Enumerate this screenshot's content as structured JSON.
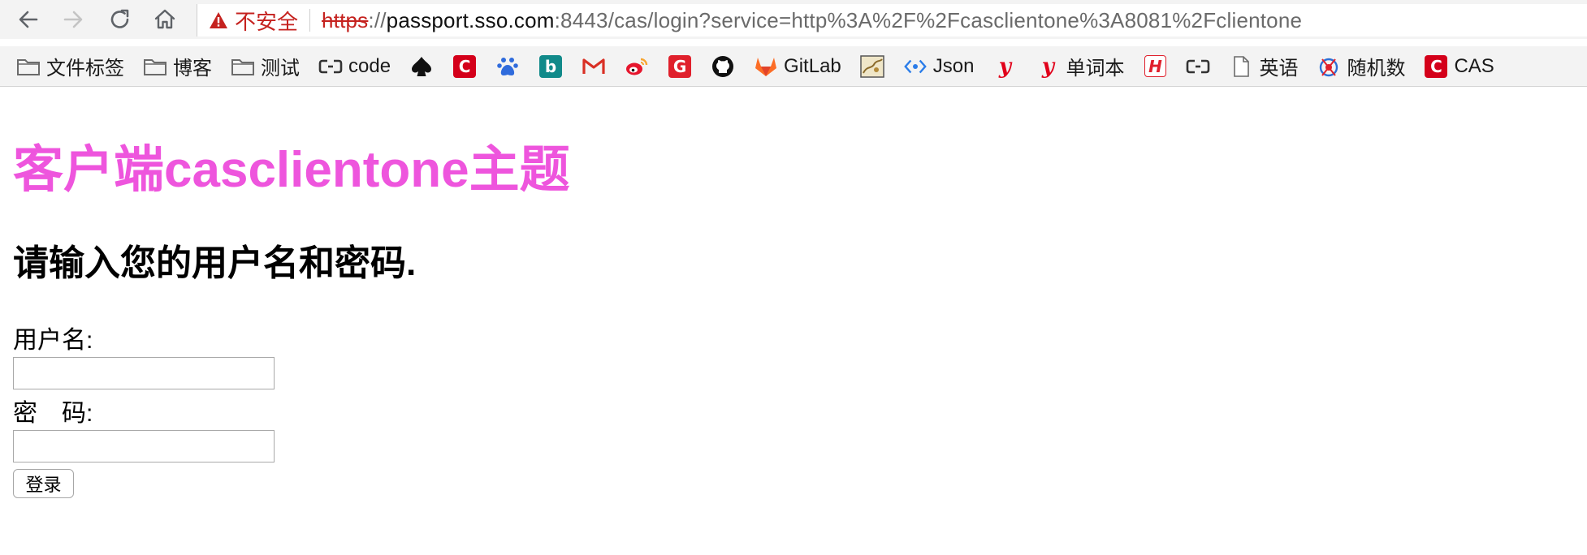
{
  "browser": {
    "security_label": "不安全",
    "url": {
      "scheme": "https",
      "separator": "://",
      "host": "passport.sso.com",
      "rest": ":8443/cas/login?service=http%3A%2F%2Fcasclientone%3A8081%2Fclientone"
    },
    "icons": {
      "back": "arrow-left-icon",
      "forward": "arrow-right-icon",
      "reload": "reload-icon",
      "home": "home-icon",
      "security": "warning-triangle-icon"
    },
    "colors": {
      "insecure": "#c5221f",
      "toolbar_bg": "#f3f3f3"
    }
  },
  "bookmarks": [
    {
      "icon": "folder-icon",
      "label": "文件标签"
    },
    {
      "icon": "folder-icon",
      "label": "博客"
    },
    {
      "icon": "folder-icon",
      "label": "测试"
    },
    {
      "icon": "link-icon",
      "label": "code"
    },
    {
      "icon": "spade-icon",
      "label": ""
    },
    {
      "icon": "c-logo-icon",
      "label": ""
    },
    {
      "icon": "baidu-paw-icon",
      "label": ""
    },
    {
      "icon": "bing-icon",
      "label": ""
    },
    {
      "icon": "gmail-icon",
      "label": ""
    },
    {
      "icon": "weibo-icon",
      "label": ""
    },
    {
      "icon": "g-logo-icon",
      "label": ""
    },
    {
      "icon": "github-icon",
      "label": ""
    },
    {
      "icon": "gitlab-icon",
      "label": "GitLab"
    },
    {
      "icon": "image-thumb-icon",
      "label": ""
    },
    {
      "icon": "json-icon",
      "label": "Json"
    },
    {
      "icon": "youdao-icon",
      "label": ""
    },
    {
      "icon": "youdao-icon",
      "label": "单词本"
    },
    {
      "icon": "h-logo-icon",
      "label": ""
    },
    {
      "icon": "link-icon",
      "label": ""
    },
    {
      "icon": "page-icon",
      "label": "英语"
    },
    {
      "icon": "random-icon",
      "label": "随机数"
    },
    {
      "icon": "c-logo-icon",
      "label": "CAS"
    }
  ],
  "page": {
    "client_title": "客户端casclientone主题",
    "prompt": "请输入您的用户名和密码.",
    "username_label": "用户名:",
    "username_value": "",
    "password_label": "密　码:",
    "password_value": "",
    "login_button": "登录",
    "colors": {
      "title": "#ee55dd"
    }
  }
}
